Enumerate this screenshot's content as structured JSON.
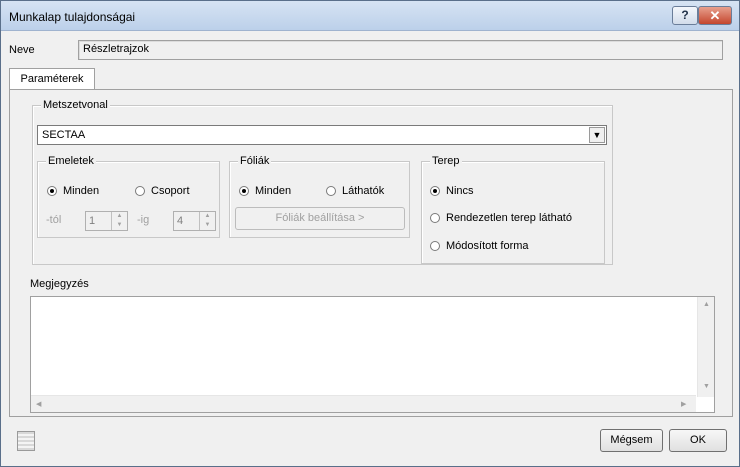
{
  "window": {
    "title": "Munkalap tulajdonságai",
    "help_label": "?",
    "close_label": "✕"
  },
  "name_field": {
    "label": "Neve",
    "value": "Részletrajzok"
  },
  "tabs": [
    {
      "label": "Paraméterek",
      "active": true
    }
  ],
  "section_group": {
    "title": "Metszetvonal",
    "selected": "SECTAA",
    "dropdown_icon": "chevron-down-icon"
  },
  "floors": {
    "title": "Emeletek",
    "options": [
      {
        "label": "Minden",
        "selected": true
      },
      {
        "label": "Csoport",
        "selected": false
      }
    ],
    "from_label": "-tól",
    "from_value": "1",
    "to_label": "-ig",
    "to_value": "4"
  },
  "layers": {
    "title": "Fóliák",
    "options": [
      {
        "label": "Minden",
        "selected": true
      },
      {
        "label": "Láthatók",
        "selected": false
      }
    ],
    "settings_button": "Fóliák beállítása >"
  },
  "terrain": {
    "title": "Terep",
    "options": [
      {
        "label": "Nincs",
        "selected": true
      },
      {
        "label": "Rendezetlen terep látható",
        "selected": false
      },
      {
        "label": "Módosított forma",
        "selected": false
      }
    ]
  },
  "note": {
    "label": "Megjegyzés",
    "value": ""
  },
  "footer": {
    "cancel_label": "Mégsem",
    "ok_label": "OK"
  }
}
